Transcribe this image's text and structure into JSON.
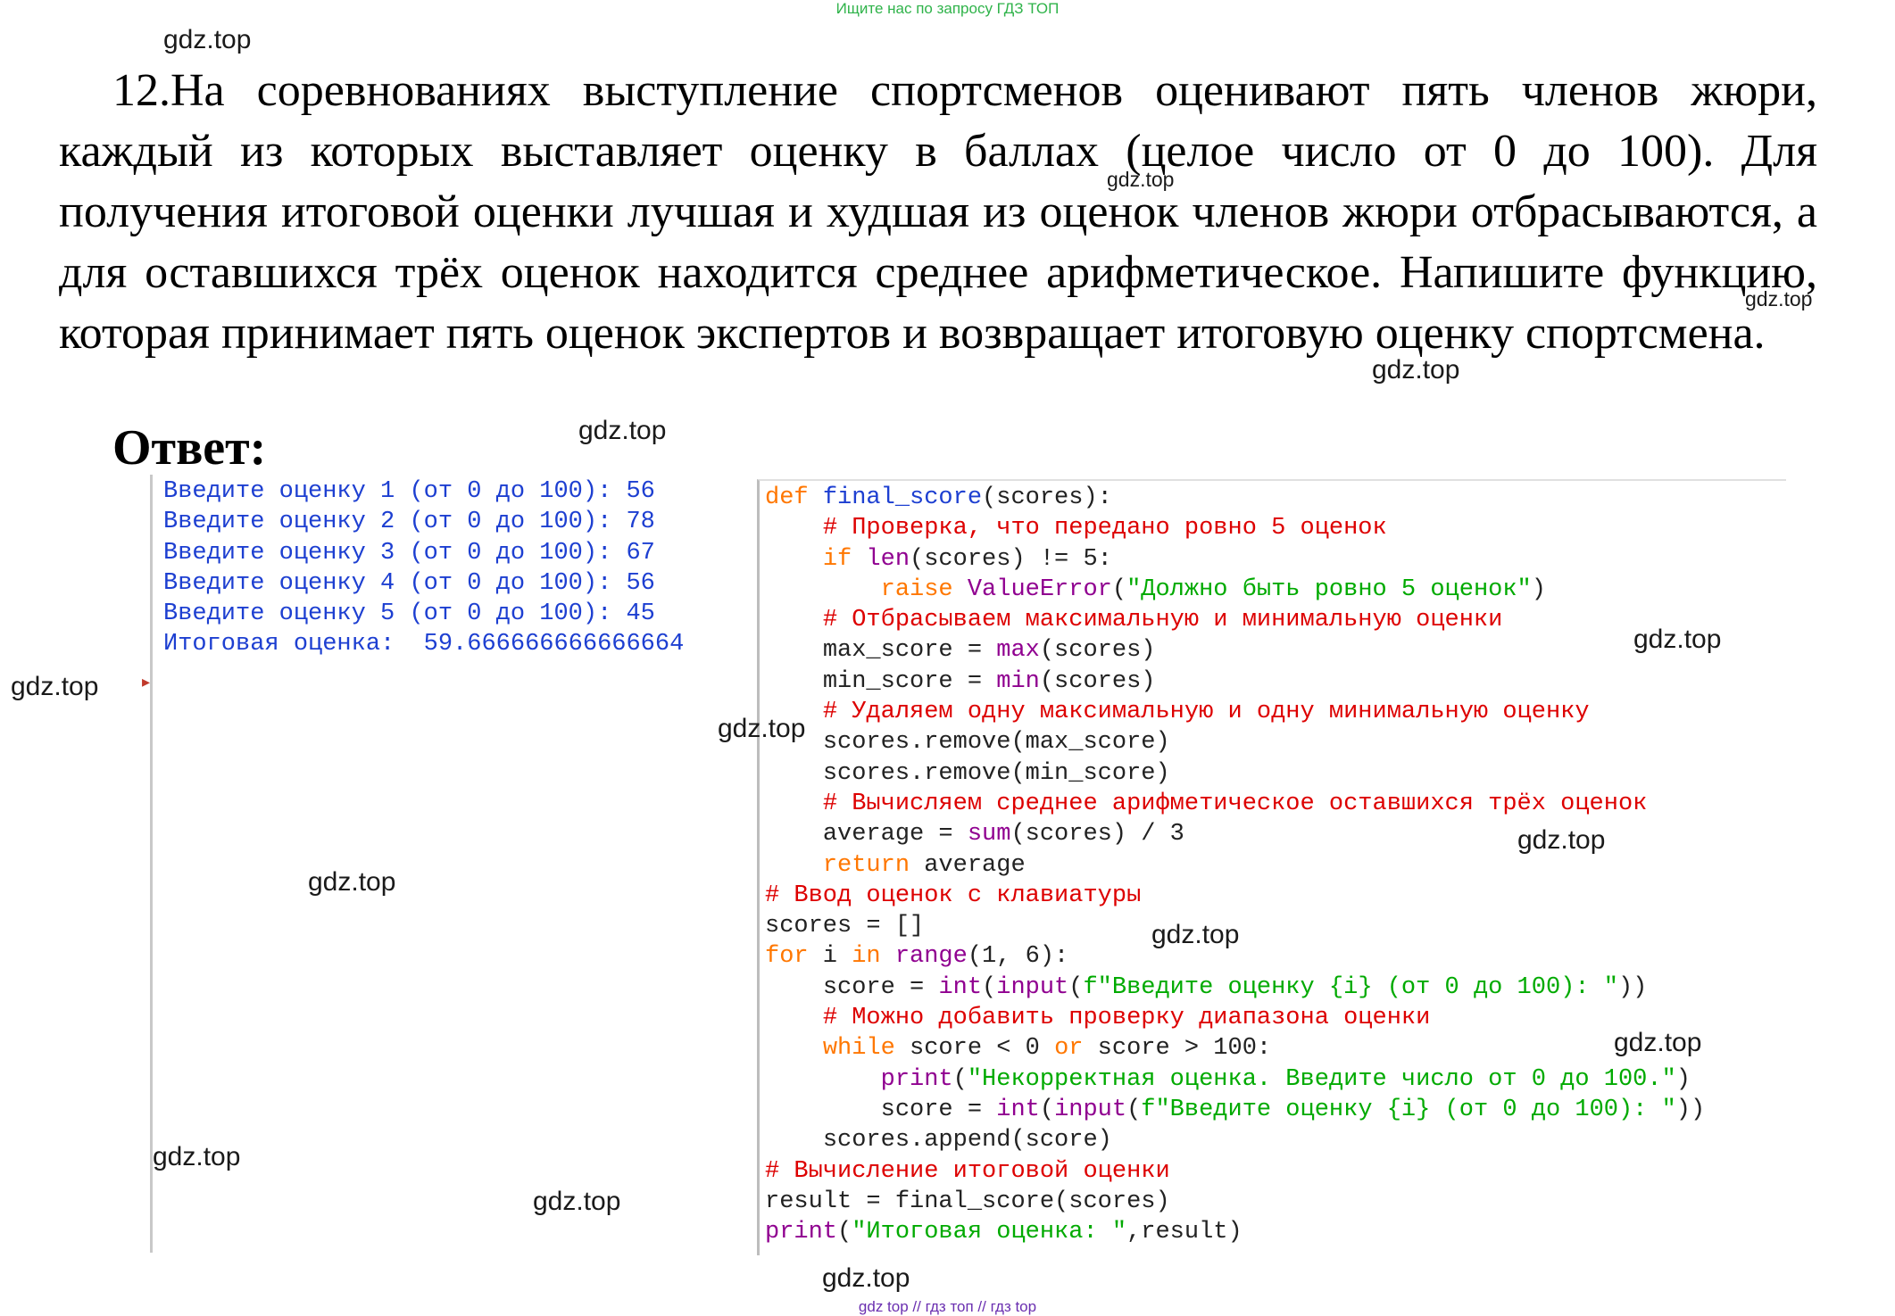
{
  "banner": "Ищите нас по запросу ГДЗ ТОП",
  "watermark_text": "gdz.top",
  "problem": {
    "number": "12.",
    "text": "На соревнованиях выступление спортсменов оценивают пять членов жюри, каждый из которых выставляет оценку в баллах (целое число от 0 до 100). Для получения итоговой оценки лучшая и худшая из оценок членов жюри отбрасываются, а для оставшихся трёх оценок находится среднее арифметическое. Напишите функцию, которая принимает пять оценок экспертов и возвращает итоговую оценку спортсмена."
  },
  "answer_label": "Ответ:",
  "shell_output": [
    "Введите оценку 1 (от 0 до 100): 56",
    "Введите оценку 2 (от 0 до 100): 78",
    "Введите оценку 3 (от 0 до 100): 67",
    "Введите оценку 4 (от 0 до 100): 56",
    "Введите оценку 5 (от 0 до 100): 45",
    "Итоговая оценка:  59.666666666666664"
  ],
  "code": {
    "l1_kw": "def",
    "l1_fn": "final_score",
    "l1_rest": "(scores):",
    "l2": "# Проверка, что передано ровно 5 оценок",
    "l3_kw": "if",
    "l3_bi": "len",
    "l3_rest": "(scores) != 5:",
    "l4_kw": "raise",
    "l4_bi": "ValueError",
    "l4_str": "\"Должно быть ровно 5 оценок\"",
    "l5": "# Отбрасываем максимальную и минимальную оценки",
    "l6_a": "max_score = ",
    "l6_bi": "max",
    "l6_b": "(scores)",
    "l7_a": "min_score = ",
    "l7_bi": "min",
    "l7_b": "(scores)",
    "l8": "# Удаляем одну максимальную и одну минимальную оценку",
    "l9": "scores.remove(max_score)",
    "l10": "scores.remove(min_score)",
    "l11": "# Вычисляем среднее арифметическое оставшихся трёх оценок",
    "l12_a": "average = ",
    "l12_bi": "sum",
    "l12_b": "(scores) / 3",
    "l13_kw": "return",
    "l13_b": " average",
    "l14": "# Ввод оценок с клавиатуры",
    "l15": "scores = []",
    "l16_kw1": "for",
    "l16_a": " i ",
    "l16_kw2": "in",
    "l16_bi": "range",
    "l16_b": "(1, 6):",
    "l17_a": "score = ",
    "l17_bi1": "int",
    "l17_bi2": "input",
    "l17_str": "f\"Введите оценку {i} (от 0 до 100): \"",
    "l18": "# Можно добавить проверку диапазона оценки",
    "l19_kw": "while",
    "l19_a": " score < 0 ",
    "l19_kw2": "or",
    "l19_b": " score > 100:",
    "l20_bi": "print",
    "l20_str": "\"Некорректная оценка. Введите число от 0 до 100.\"",
    "l21_a": "score = ",
    "l21_bi1": "int",
    "l21_bi2": "input",
    "l21_str": "f\"Введите оценку {i} (от 0 до 100): \"",
    "l22": "scores.append(score)",
    "l23": "# Вычисление итоговой оценки",
    "l24": "result = final_score(scores)",
    "l25_bi": "print",
    "l25_str": "\"Итоговая оценка: \"",
    "l25_b": ",result)"
  },
  "bottom_links": "gdz top  //  гдз топ  //  гдз top"
}
